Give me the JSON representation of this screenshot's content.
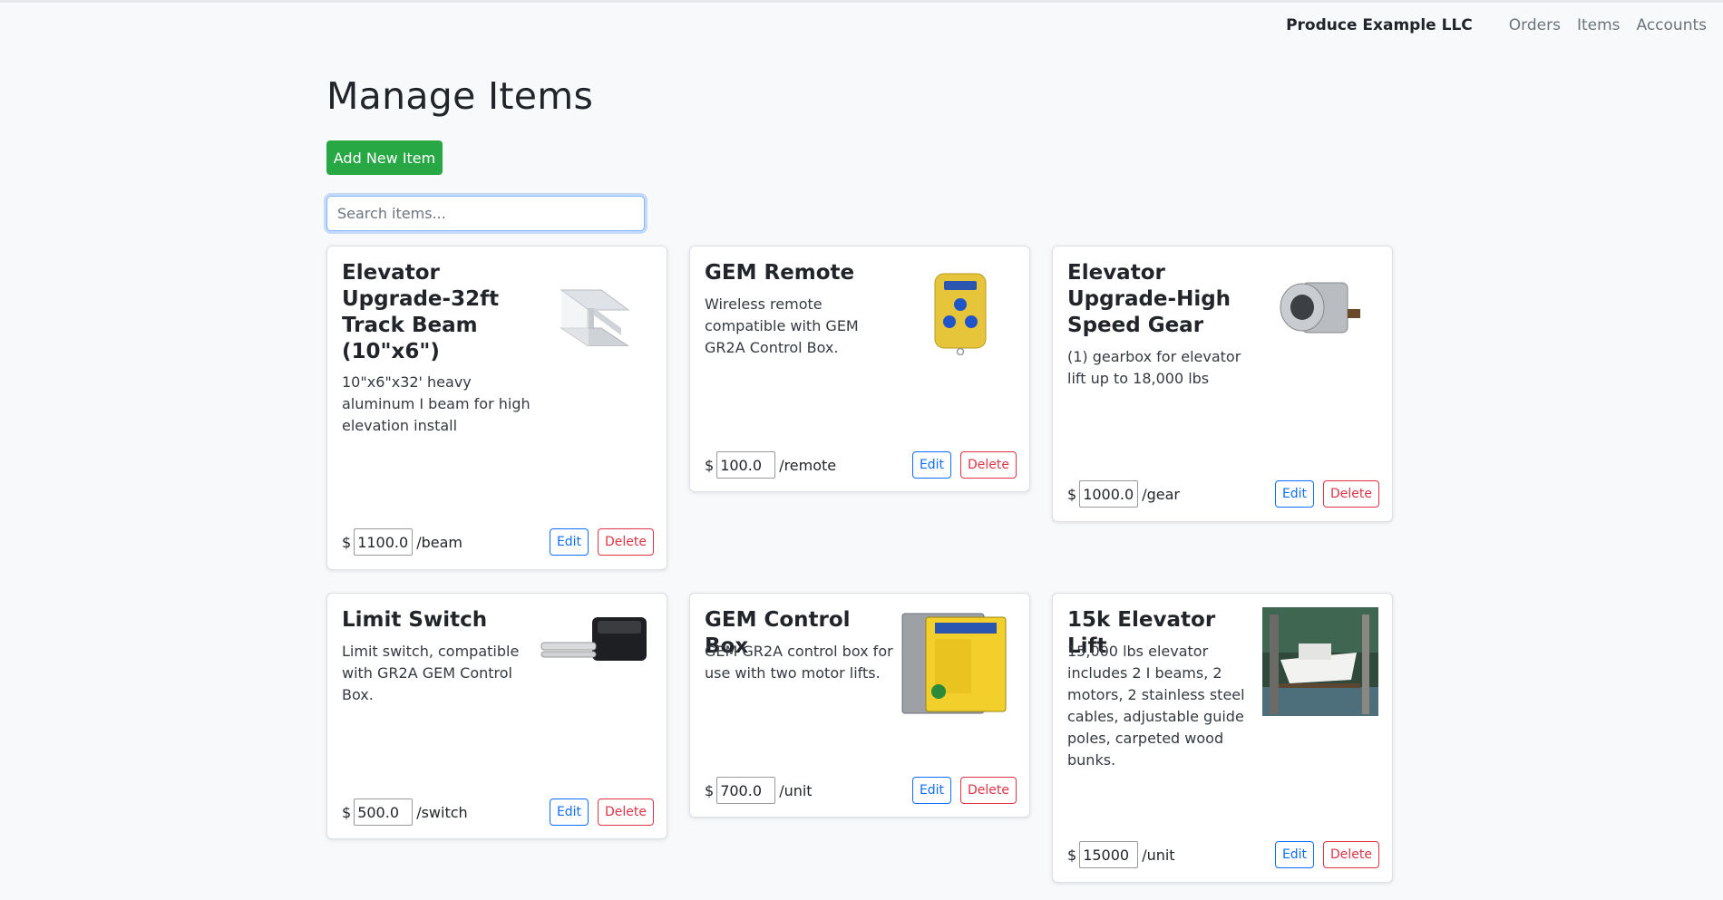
{
  "navbar": {
    "brand": "Produce Example LLC",
    "links": [
      "Orders",
      "Items",
      "Accounts"
    ]
  },
  "page": {
    "title": "Manage Items",
    "add_button": "Add New Item",
    "search_placeholder": "Search items..."
  },
  "items": [
    {
      "title": "Elevator Upgrade-32ft Track Beam (10\"x6\")",
      "description": "10\"x6\"x32' heavy aluminum I beam for high elevation install",
      "price": "1100.0",
      "unit": "/beam",
      "image_icon": "i-beam-image"
    },
    {
      "title": "GEM Remote",
      "description": "Wireless remote compatible with GEM GR2A Control Box.",
      "price": "100.0",
      "unit": "/remote",
      "image_icon": "remote-image"
    },
    {
      "title": "Elevator Upgrade-High Speed Gear",
      "description": "(1) gearbox for elevator lift up to 18,000 lbs",
      "price": "1000.0",
      "unit": "/gear",
      "image_icon": "gearbox-image"
    },
    {
      "title": "Limit Switch",
      "description": "Limit switch, compatible with GR2A GEM Control Box.",
      "price": "500.0",
      "unit": "/switch",
      "image_icon": "limit-switch-image"
    },
    {
      "title": "GEM Control Box",
      "description": "GEM GR2A control box for use with two motor lifts.",
      "price": "700.0",
      "unit": "/unit",
      "image_icon": "control-box-image"
    },
    {
      "title": "15k Elevator Lift",
      "description": "15,000 lbs elevator includes 2 I beams, 2 motors, 2 stainless steel cables, adjustable guide poles, carpeted wood bunks.",
      "price": "15000",
      "unit": "/unit",
      "image_icon": "boat-lift-photo"
    }
  ],
  "labels": {
    "currency": "$",
    "edit": "Edit",
    "delete": "Delete"
  },
  "colors": {
    "add_button": "#28a745",
    "edit": "#0d6efd",
    "delete": "#dc3545"
  }
}
